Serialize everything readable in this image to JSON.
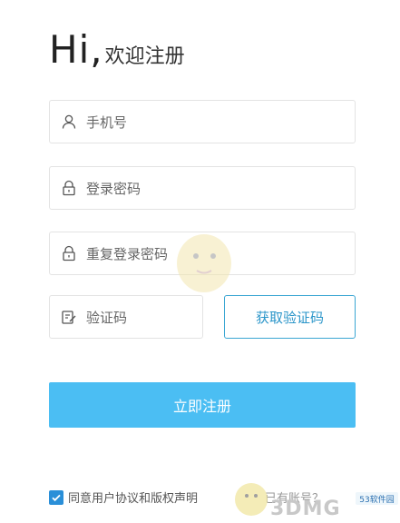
{
  "header": {
    "hi": "Hi,",
    "welcome": "欢迎注册"
  },
  "form": {
    "phone_placeholder": "手机号",
    "password_placeholder": "登录密码",
    "confirm_placeholder": "重复登录密码",
    "code_placeholder": "验证码",
    "get_code_label": "获取验证码",
    "submit_label": "立即注册"
  },
  "footer": {
    "agree_text": "同意用户协议和版权声明",
    "login_prompt": "已有账号？"
  },
  "watermark": {
    "brand": "3DMG",
    "site": "53软件园"
  },
  "colors": {
    "primary": "#4bbef3",
    "accent_border": "#3aa6d3",
    "checkbox": "#2a8fd8"
  },
  "icons": {
    "phone": "user-icon",
    "password": "lock-icon",
    "code": "edit-icon",
    "check": "check-icon"
  }
}
